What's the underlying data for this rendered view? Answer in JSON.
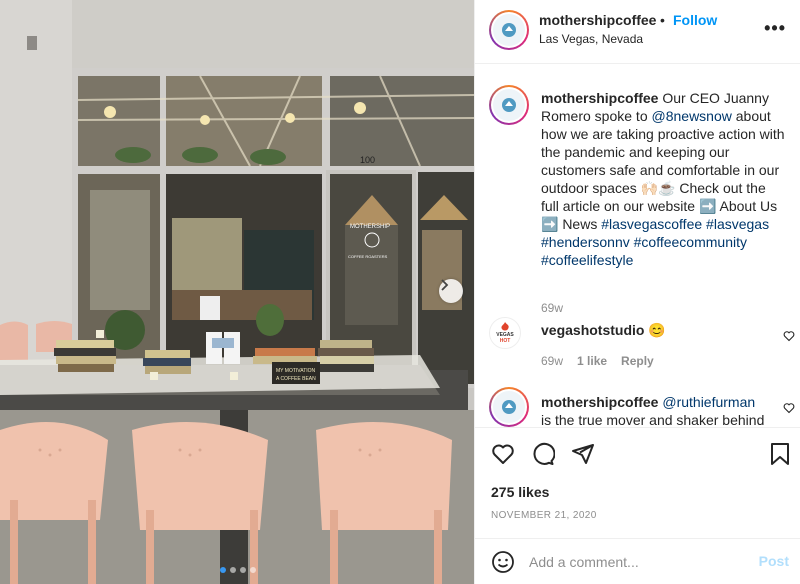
{
  "post": {
    "username": "mothershipcoffee",
    "follow_label": "Follow",
    "separator": "•",
    "location": "Las Vegas, Nevada",
    "more_label": "•••",
    "avatar_text": "MOTHERSHIP",
    "photo_texts": {
      "address_number": "100",
      "sign_title": "MOTHERSHIP",
      "sign_subtitle": "COFFEE ROASTERS",
      "table_sign_line1": "MY MOTIVATION",
      "table_sign_line2": "A COFFEE BEAN"
    },
    "photo_dots_count": 4
  },
  "caption": {
    "username": "mothershipcoffee",
    "text_1": " Our CEO Juanny Romero spoke to ",
    "mention": "@8newsnow",
    "text_2": " about how we are taking proactive action with the pandemic and keeping our customers safe and comfortable in our outdoor spaces 🙌🏻☕️ Check out the full article on our website ➡️ About Us ➡️ News ",
    "hashtags": [
      "#lasvegascoffee",
      "#lasvegas",
      "#hendersonnv",
      "#coffeecommunity",
      "#coffeelifestyle"
    ],
    "time": "69w"
  },
  "comments": [
    {
      "username": "vegashotstudio",
      "text": " 😊",
      "time": "69w",
      "likes": "1 like",
      "reply_label": "Reply",
      "avatar_text_top": "VEGAS",
      "avatar_text_bottom": "HOT"
    },
    {
      "username": "mothershipcoffee",
      "mention": "@ruthiefurman",
      "text": "is the true mover and shaker behind"
    }
  ],
  "actions": {
    "likes": "275 likes",
    "date": "NOVEMBER 21, 2020"
  },
  "add_comment": {
    "placeholder": "Add a comment...",
    "post_label": "Post"
  },
  "colors": {
    "follow": "#0095f6",
    "link": "#00376b",
    "muted": "#8e8e8e",
    "post_disabled": "#b2dffc"
  }
}
